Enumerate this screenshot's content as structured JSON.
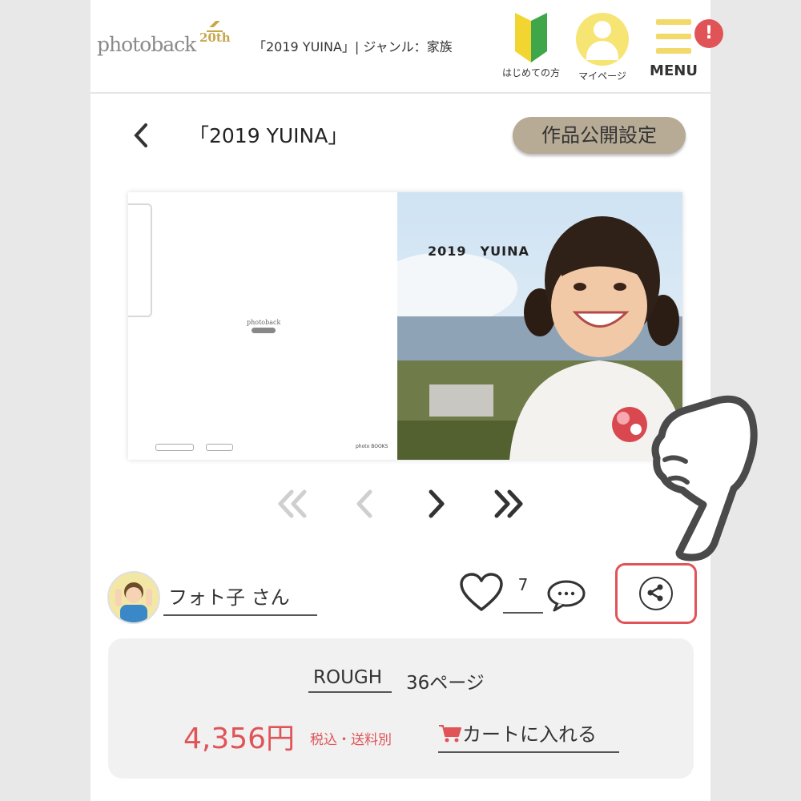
{
  "header": {
    "logo_text": "photoback",
    "logo_badge": "20th",
    "title": "「2019 YUINA」| ジャンル：家族",
    "beginner_label": "はじめての方",
    "mypage_label": "マイページ",
    "menu_label": "MENU",
    "notification_badge": "!"
  },
  "title_row": {
    "back_icon": "‹",
    "title": "「2019 YUINA」",
    "visibility_button": "作品公開設定"
  },
  "book": {
    "cover_title": "2019　YUINA",
    "mini_logo": "photoback",
    "back_cover_text": "photo BOOKS"
  },
  "pager": {
    "first": "«",
    "prev": "‹",
    "next": "›",
    "last": "»"
  },
  "user": {
    "name": "フォト子 さん",
    "like_count": "7"
  },
  "product": {
    "name": "ROUGH",
    "pages": "36ページ",
    "price": "4,356円",
    "tax_note": "税込・送料別",
    "cart_label": "カートに入れる"
  },
  "colors": {
    "accent_red": "#e05458",
    "button_beige": "#b7ab95",
    "menu_yellow": "#f2d96a",
    "card_bg": "#f1f1f1"
  }
}
